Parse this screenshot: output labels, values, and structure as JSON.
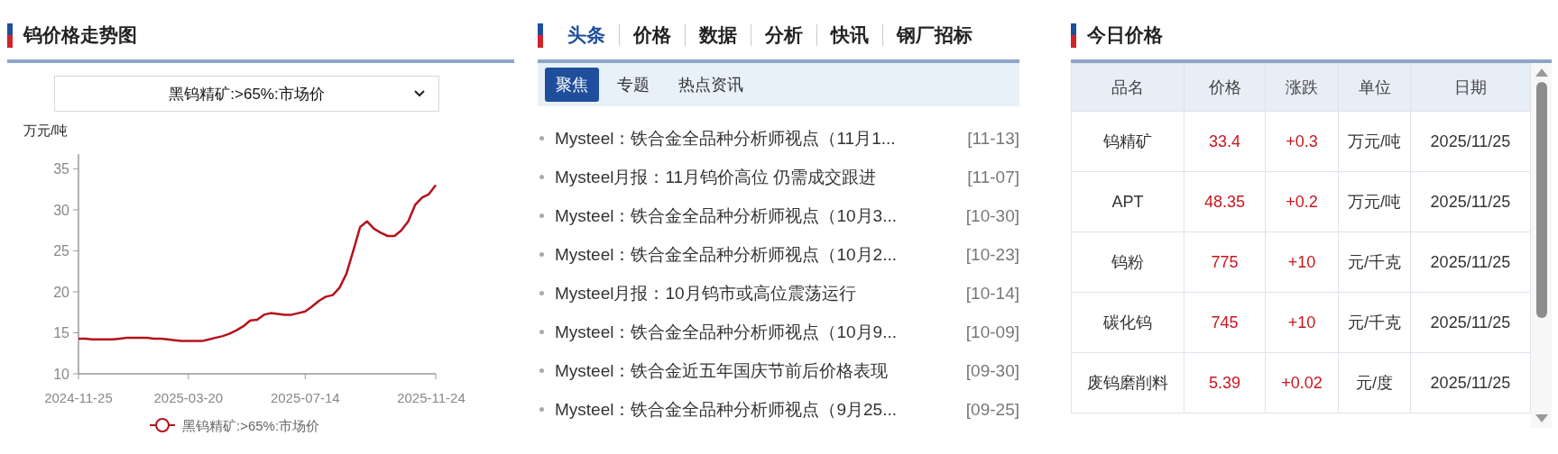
{
  "price_trend": {
    "title": "钨价格走势图",
    "product_select": {
      "value": "黑钨精矿:>65%:市场价"
    },
    "chart_data": {
      "type": "line",
      "ylabel": "万元/吨",
      "categories": [
        "2024-11-25",
        null,
        null,
        null,
        null,
        null,
        null,
        null,
        null,
        null,
        null,
        null,
        null,
        null,
        null,
        null,
        "2025-03-20",
        null,
        null,
        null,
        null,
        null,
        null,
        null,
        null,
        null,
        null,
        null,
        null,
        null,
        null,
        null,
        null,
        "2025-07-14",
        null,
        null,
        null,
        null,
        null,
        null,
        null,
        null,
        null,
        null,
        null,
        null,
        null,
        null,
        null,
        null,
        null,
        null,
        "2025-11-24"
      ],
      "ylim": [
        10,
        36.8
      ],
      "yticks": [
        10,
        15,
        20,
        25,
        30,
        35
      ],
      "series": [
        {
          "name": "黑钨精矿:>65%:市场价",
          "color": "#b5121b",
          "values": [
            14.3,
            14.3,
            14.2,
            14.2,
            14.2,
            14.2,
            14.3,
            14.4,
            14.4,
            14.4,
            14.4,
            14.3,
            14.3,
            14.2,
            14.1,
            14.0,
            14.0,
            14.0,
            14.0,
            14.2,
            14.4,
            14.6,
            14.9,
            15.3,
            15.8,
            16.5,
            16.6,
            17.2,
            17.4,
            17.3,
            17.2,
            17.2,
            17.4,
            17.6,
            18.2,
            18.9,
            19.4,
            19.6,
            20.5,
            22.2,
            25.0,
            27.9,
            28.6,
            27.7,
            27.2,
            26.8,
            26.8,
            27.5,
            28.6,
            30.6,
            31.5,
            31.9,
            33.0
          ]
        }
      ]
    }
  },
  "news": {
    "tabs": [
      {
        "label": "头条",
        "selected": true
      },
      {
        "label": "价格",
        "selected": false
      },
      {
        "label": "数据",
        "selected": false
      },
      {
        "label": "分析",
        "selected": false
      },
      {
        "label": "快讯",
        "selected": false
      },
      {
        "label": "钢厂招标",
        "selected": false
      }
    ],
    "subtabs": [
      {
        "label": "聚焦",
        "selected": true
      },
      {
        "label": "专题",
        "selected": false
      },
      {
        "label": "热点资讯",
        "selected": false
      }
    ],
    "items": [
      {
        "title": "Mysteel：铁合金全品种分析师视点（11月1...",
        "date": "[11-13]"
      },
      {
        "title": "Mysteel月报：11月钨价高位 仍需成交跟进",
        "date": "[11-07]"
      },
      {
        "title": "Mysteel：铁合金全品种分析师视点（10月3...",
        "date": "[10-30]"
      },
      {
        "title": "Mysteel：铁合金全品种分析师视点（10月2...",
        "date": "[10-23]"
      },
      {
        "title": "Mysteel月报：10月钨市或高位震荡运行",
        "date": "[10-14]"
      },
      {
        "title": "Mysteel：铁合金全品种分析师视点（10月9...",
        "date": "[10-09]"
      },
      {
        "title": "Mysteel：铁合金近五年国庆节前后价格表现",
        "date": "[09-30]"
      },
      {
        "title": "Mysteel：铁合金全品种分析师视点（9月25...",
        "date": "[09-25]"
      }
    ]
  },
  "today_prices": {
    "title": "今日价格",
    "table": {
      "columns": [
        "品名",
        "价格",
        "涨跌",
        "单位",
        "日期"
      ],
      "rows": [
        {
          "name": "钨精矿",
          "price": "33.4",
          "change": "+0.3",
          "unit": "万元/吨",
          "date": "2025/11/25"
        },
        {
          "name": "APT",
          "price": "48.35",
          "change": "+0.2",
          "unit": "万元/吨",
          "date": "2025/11/25"
        },
        {
          "name": "钨粉",
          "price": "775",
          "change": "+10",
          "unit": "元/千克",
          "date": "2025/11/25"
        },
        {
          "name": "碳化钨",
          "price": "745",
          "change": "+10",
          "unit": "元/千克",
          "date": "2025/11/25"
        },
        {
          "name": "废钨磨削料",
          "price": "5.39",
          "change": "+0.02",
          "unit": "元/度",
          "date": "2025/11/25"
        }
      ]
    }
  }
}
